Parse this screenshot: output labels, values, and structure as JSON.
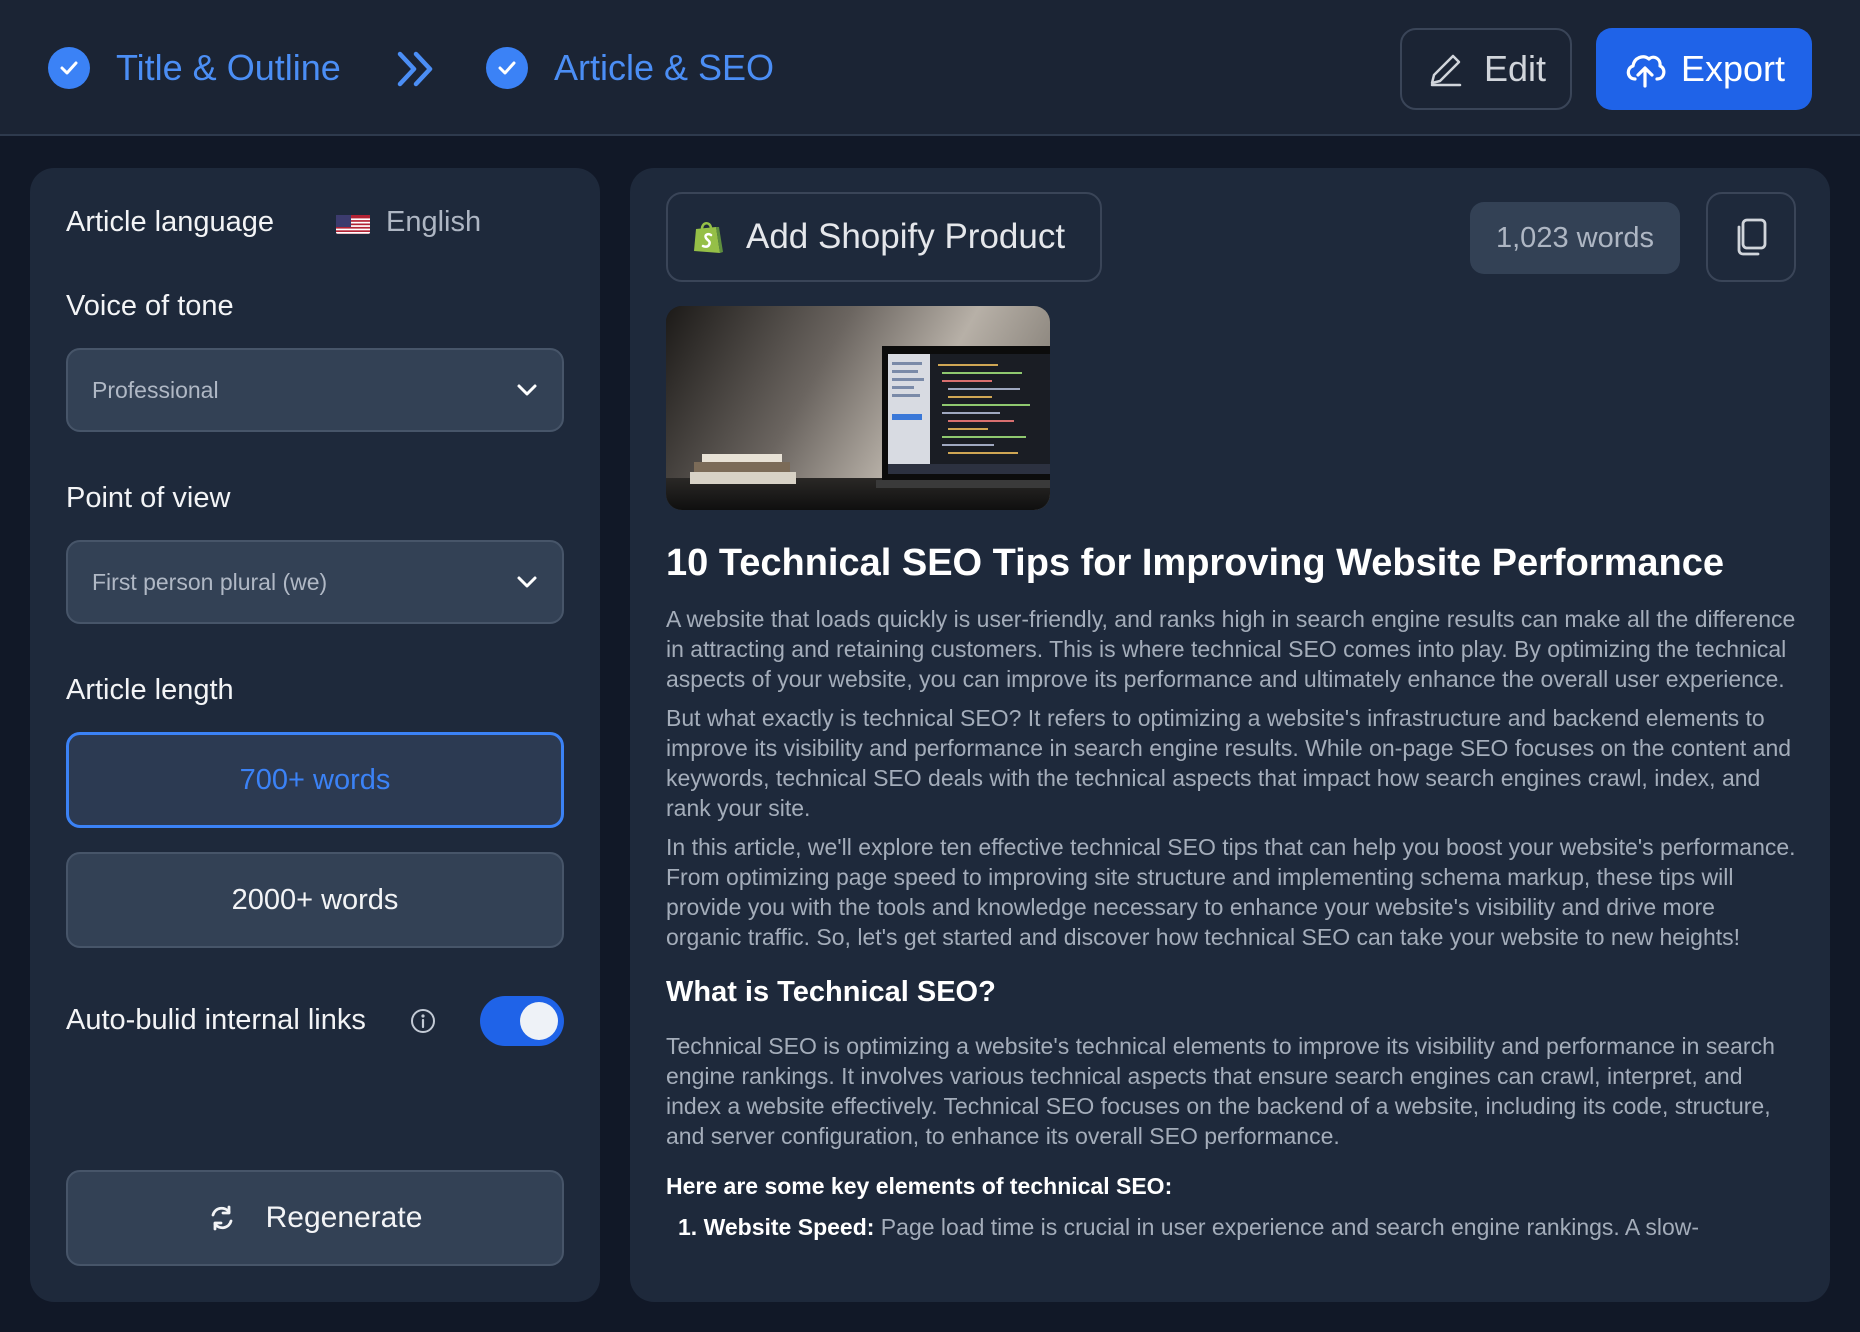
{
  "header": {
    "steps": [
      {
        "label": "Title & Outline"
      },
      {
        "label": "Article & SEO"
      }
    ],
    "edit_label": "Edit",
    "export_label": "Export",
    "accent_color": "#1f63e8"
  },
  "settings": {
    "language_label": "Article language",
    "language_value": "English",
    "tone_label": "Voice of tone",
    "tone_value": "Professional",
    "pov_label": "Point of view",
    "pov_value": "First person plural (we)",
    "length_label": "Article length",
    "length_options": [
      {
        "label": "700+ words",
        "selected": true
      },
      {
        "label": "2000+ words",
        "selected": false
      }
    ],
    "internal_links_label": "Auto-bulid internal links",
    "internal_links_enabled": true,
    "regenerate_label": "Regenerate"
  },
  "article": {
    "shopify_label": "Add Shopify Product",
    "word_count": "1,023 words",
    "title": "10 Technical SEO Tips for Improving Website Performance",
    "intro": [
      "A website that loads quickly is user-friendly, and ranks high in search engine results can make all the difference in attracting and retaining customers. This is where technical SEO comes into play. By optimizing the technical aspects of your website, you can improve its performance and ultimately enhance the overall user experience.",
      "But what exactly is technical SEO? It refers to optimizing a website's infrastructure and backend elements to improve its visibility and performance in search engine results. While on-page SEO focuses on the content and keywords, technical SEO deals with the technical aspects that impact how search engines crawl, index, and rank your site.",
      "In this article, we'll explore ten effective technical SEO tips that can help you boost your website's performance. From optimizing page speed to improving site structure and implementing schema markup, these tips will provide you with the tools and knowledge necessary to enhance your website's visibility and drive more organic traffic. So, let's get started and discover how technical SEO can take your website to new heights!"
    ],
    "section_heading": "What is Technical SEO?",
    "section_body": "Technical SEO is optimizing a website's technical elements to improve its visibility and performance in search engine rankings. It involves various technical aspects that ensure search engines can crawl, interpret, and index a website effectively. Technical SEO focuses on the backend of a website, including its code, structure, and server configuration, to enhance its overall SEO performance.",
    "key_heading": "Here are some key elements of technical SEO:",
    "list": [
      {
        "num": "1.",
        "term": "Website Speed:",
        "text": " Page load time is crucial in user experience and search engine rankings. A slow-"
      }
    ]
  }
}
